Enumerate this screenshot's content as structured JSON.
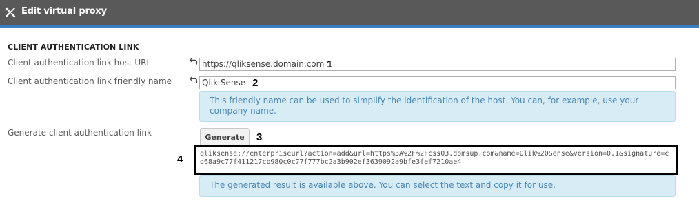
{
  "header": {
    "title": "Edit virtual proxy",
    "icon": "tools-icon",
    "background_color": "#595959",
    "accent_color": "#3b80c6"
  },
  "section": {
    "title": "CLIENT AUTHENTICATION LINK"
  },
  "fields": {
    "host_uri": {
      "label": "Client authentication link host URI",
      "value": "https://qliksense.domain.com",
      "marker": "1"
    },
    "friendly_name": {
      "label": "Client authentication link friendly name",
      "value": "Qlik Sense",
      "marker": "2",
      "info": "This friendly name can be used to simplify the identification of the host. You can, for example, use your company name."
    },
    "generate": {
      "label": "Generate client authentication link",
      "button_label": "Generate",
      "marker": "3"
    },
    "generated_link": {
      "value": "qliksense://enterpriseurl?action=add&url=https%3A%2F%2Fcss03.domsup.com&name=Qlik%20Sense&version=0.1&signature=cd68a9c77f411217cb980c0c77f777bc2a3b902ef3639092a9bfe3fef7210ae4",
      "marker": "4",
      "info": "The generated result is available above. You can select the text and copy it for use."
    }
  },
  "colors": {
    "info_background": "#d8ecf6",
    "info_text": "#4a87b4"
  }
}
